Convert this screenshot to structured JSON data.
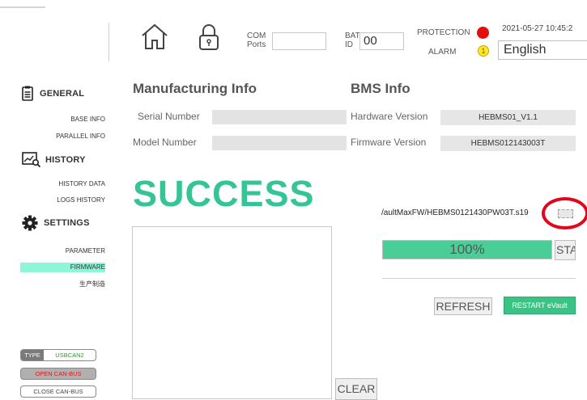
{
  "header": {
    "com_ports_label_1": "COM",
    "com_ports_label_2": "Ports",
    "com_ports_value": "",
    "bat_label_1": "BAT",
    "bat_label_2": "ID",
    "bat_id_value": "00",
    "protection_label": "PROTECTION",
    "alarm_label": "ALARM",
    "alarm_count": "1",
    "datetime": "2021-05-27 10:45:2",
    "language": "English"
  },
  "sidebar": {
    "general": {
      "title": "GENERAL",
      "items": [
        "BASE INFO",
        "PARALLEL INFO"
      ]
    },
    "history": {
      "title": "HISTORY",
      "items": [
        "HISTORY DATA",
        "LOGS HISTORY"
      ]
    },
    "settings": {
      "title": "SETTINGS",
      "items": [
        "PARAMETER",
        "FIRMWARE",
        "生产制造"
      ]
    },
    "type_label": "TYPE",
    "type_value": "USBCAN2",
    "open_can_bus": "OPEN CAN-BUS",
    "close_can_bus": "CLOSE CAN-BUS"
  },
  "manufacturing": {
    "title": "Manufacturing Info",
    "serial_number_label": "Serial Number",
    "serial_number_value": "",
    "model_number_label": "Model Number",
    "model_number_value": ""
  },
  "bms": {
    "title": "BMS Info",
    "hardware_version_label": "Hardware Version",
    "hardware_version_value": "HEBMS01_V1.1",
    "firmware_version_label": "Firmware Version",
    "firmware_version_value": "HEBMS012143003T"
  },
  "firmware": {
    "status_text": "SUCCESS",
    "file_path": "/aultMaxFW/HEBMS0121430PW03T.s19",
    "progress_text": "100%",
    "progress_fraction": 1.0,
    "start_label": "START",
    "refresh_label": "REFRESH",
    "restart_label": "RESTART eVault",
    "clear_label": "CLEAR"
  },
  "colors": {
    "success": "#34c495",
    "progress": "#4bcd97",
    "active_nav": "#8ff5d8",
    "protection": "#e20f0f",
    "alarm": "#ffe82a",
    "restart": "#39c486",
    "highlight_circle": "#e3051b"
  }
}
